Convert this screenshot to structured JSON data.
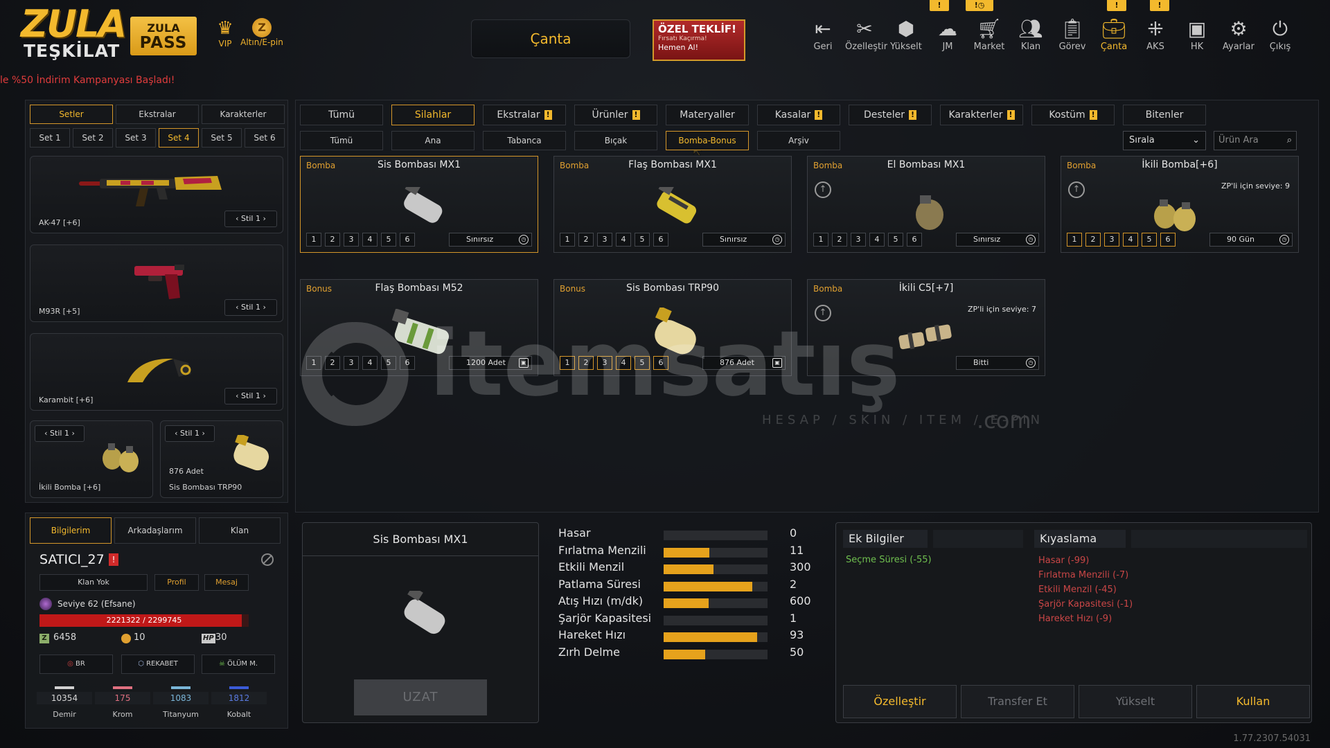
{
  "logo": {
    "line1": "ZULA",
    "line2": "TEŞKİLAT"
  },
  "zulapass": {
    "line1": "ZULA",
    "line2": "PASS"
  },
  "vip_label": "VIP",
  "altin_label": "Altın/E-pin",
  "canta_button": "Çanta",
  "offer": {
    "title": "ÖZEL TEKLİF!",
    "subtitle": "Fırsatı Kaçırma!",
    "cta": "Hemen Al!"
  },
  "nav": [
    {
      "label": "Geri",
      "icon": "back-icon"
    },
    {
      "label": "Özelleştir",
      "icon": "tools-icon"
    },
    {
      "label": "Yükselt",
      "icon": "upgrade-icon"
    },
    {
      "label": "JM",
      "icon": "jm-icon"
    },
    {
      "label": "Market",
      "icon": "cart-icon"
    },
    {
      "label": "Klan",
      "icon": "clan-icon"
    },
    {
      "label": "Görev",
      "icon": "clipboard-icon"
    },
    {
      "label": "Çanta",
      "icon": "bag-icon"
    },
    {
      "label": "AKS",
      "icon": "aks-icon"
    },
    {
      "label": "HK",
      "icon": "wallet-icon"
    },
    {
      "label": "Ayarlar",
      "icon": "gear-icon"
    },
    {
      "label": "Çıkış",
      "icon": "power-icon"
    }
  ],
  "campaign_text": "le %50 İndirim Kampanyası Başladı!",
  "left": {
    "tabs": [
      "Setler",
      "Ekstralar",
      "Karakterler"
    ],
    "sets": [
      "Set 1",
      "Set 2",
      "Set 3",
      "Set 4",
      "Set 5",
      "Set 6"
    ],
    "slots": [
      {
        "name": "AK-47 [+6]",
        "stil": "Stil 1"
      },
      {
        "name": "M93R [+5]",
        "stil": "Stil 1"
      },
      {
        "name": "Karambit [+6]",
        "stil": "Stil 1"
      },
      {
        "name": "İkili Bomba [+6]",
        "stil": "Stil 1"
      },
      {
        "name": "Sis Bombası TRP90",
        "stil": "Stil 1",
        "count": "876 Adet"
      }
    ]
  },
  "profile": {
    "tabs": [
      "Bilgilerim",
      "Arkadaşlarım",
      "Klan"
    ],
    "username": "SATICI_27",
    "buttons": [
      "Klan Yok",
      "Profil",
      "Mesaj"
    ],
    "level": "Seviye 62 (Efsane)",
    "xp": "2221322 / 2299745",
    "xp_fraction": 0.966,
    "zp": "6458",
    "gold": "10",
    "hp": "30",
    "hp_label": "HP",
    "modes": [
      "BR",
      "REKABET",
      "ÖLÜM M."
    ],
    "resources": [
      {
        "value": "10354",
        "label": "Demir",
        "color": "#d0d0d0"
      },
      {
        "value": "175",
        "label": "Krom",
        "color": "#e07080"
      },
      {
        "value": "1083",
        "label": "Titanyum",
        "color": "#7ab6d8"
      },
      {
        "value": "1812",
        "label": "Kobalt",
        "color": "#3b5bd8"
      }
    ]
  },
  "categories": [
    "Tümü",
    "Silahlar",
    "Ekstralar",
    "Ürünler",
    "Materyaller",
    "Kasalar",
    "Desteler",
    "Karakterler",
    "Kostüm",
    "Bitenler"
  ],
  "subcategories": [
    "Tümü",
    "Ana",
    "Tabanca",
    "Bıçak",
    "Bomba-Bonus",
    "Arşiv"
  ],
  "sort_label": "Sırala",
  "search_placeholder": "Ürün Ara",
  "warn_mark": "!",
  "levels": [
    "1",
    "2",
    "3",
    "4",
    "5",
    "6"
  ],
  "items": [
    {
      "type": "Bomba",
      "title": "Sis Bombası MX1",
      "duration": "Sınırsız"
    },
    {
      "type": "Bomba",
      "title": "Flaş Bombası MX1",
      "duration": "Sınırsız"
    },
    {
      "type": "Bomba",
      "title": "El Bombası MX1",
      "duration": "Sınırsız"
    },
    {
      "type": "Bomba",
      "title": "İkili Bomba[+6]",
      "duration": "90 Gün",
      "zp": "ZP'li için seviye: 9"
    },
    {
      "type": "Bonus",
      "title": "Flaş Bombası M52",
      "duration": "1200 Adet"
    },
    {
      "type": "Bonus",
      "title": "Sis Bombası TRP90",
      "duration": "876 Adet"
    },
    {
      "type": "Bomba",
      "title": "İkili C5[+7]",
      "duration": "Bitti",
      "zp": "ZP'li için seviye: 7"
    }
  ],
  "detail": {
    "title": "Sis Bombası MX1",
    "uzat": "UZAT",
    "stats": [
      {
        "label": "Hasar",
        "value": "0",
        "fill": 0
      },
      {
        "label": "Fırlatma Menzili",
        "value": "11",
        "fill": 0.44
      },
      {
        "label": "Etkili Menzil",
        "value": "300",
        "fill": 0.48
      },
      {
        "label": "Patlama Süresi",
        "value": "2",
        "fill": 0.85
      },
      {
        "label": "Atış Hızı (m/dk)",
        "value": "600",
        "fill": 0.43
      },
      {
        "label": "Şarjör Kapasitesi",
        "value": "1",
        "fill": 0
      },
      {
        "label": "Hareket Hızı",
        "value": "93",
        "fill": 0.9
      },
      {
        "label": "Zırh Delme",
        "value": "50",
        "fill": 0.4
      }
    ],
    "ek_title": "Ek Bilgiler",
    "ek_items": [
      "Seçme Süresi (-55)"
    ],
    "kiyas_title": "Kıyaslama",
    "kiyas_items": [
      "Hasar (-99)",
      "Fırlatma Menzili (-7)",
      "Etkili Menzil (-45)",
      "Şarjör Kapasitesi (-1)",
      "Hareket Hızı (-9)"
    ],
    "actions": [
      "Özelleştir",
      "Transfer Et",
      "Yükselt",
      "Kullan"
    ]
  },
  "version": "1.77.2307.54031",
  "watermark": {
    "brand": "itemsatış",
    "tagline": "HESAP / SKIN / ITEM / E-PIN",
    "suffix": ".com"
  },
  "colors": {
    "accent": "#f3b92d",
    "alert": "#e03c3c",
    "green": "#6fbf4f",
    "red": "#c94646"
  }
}
